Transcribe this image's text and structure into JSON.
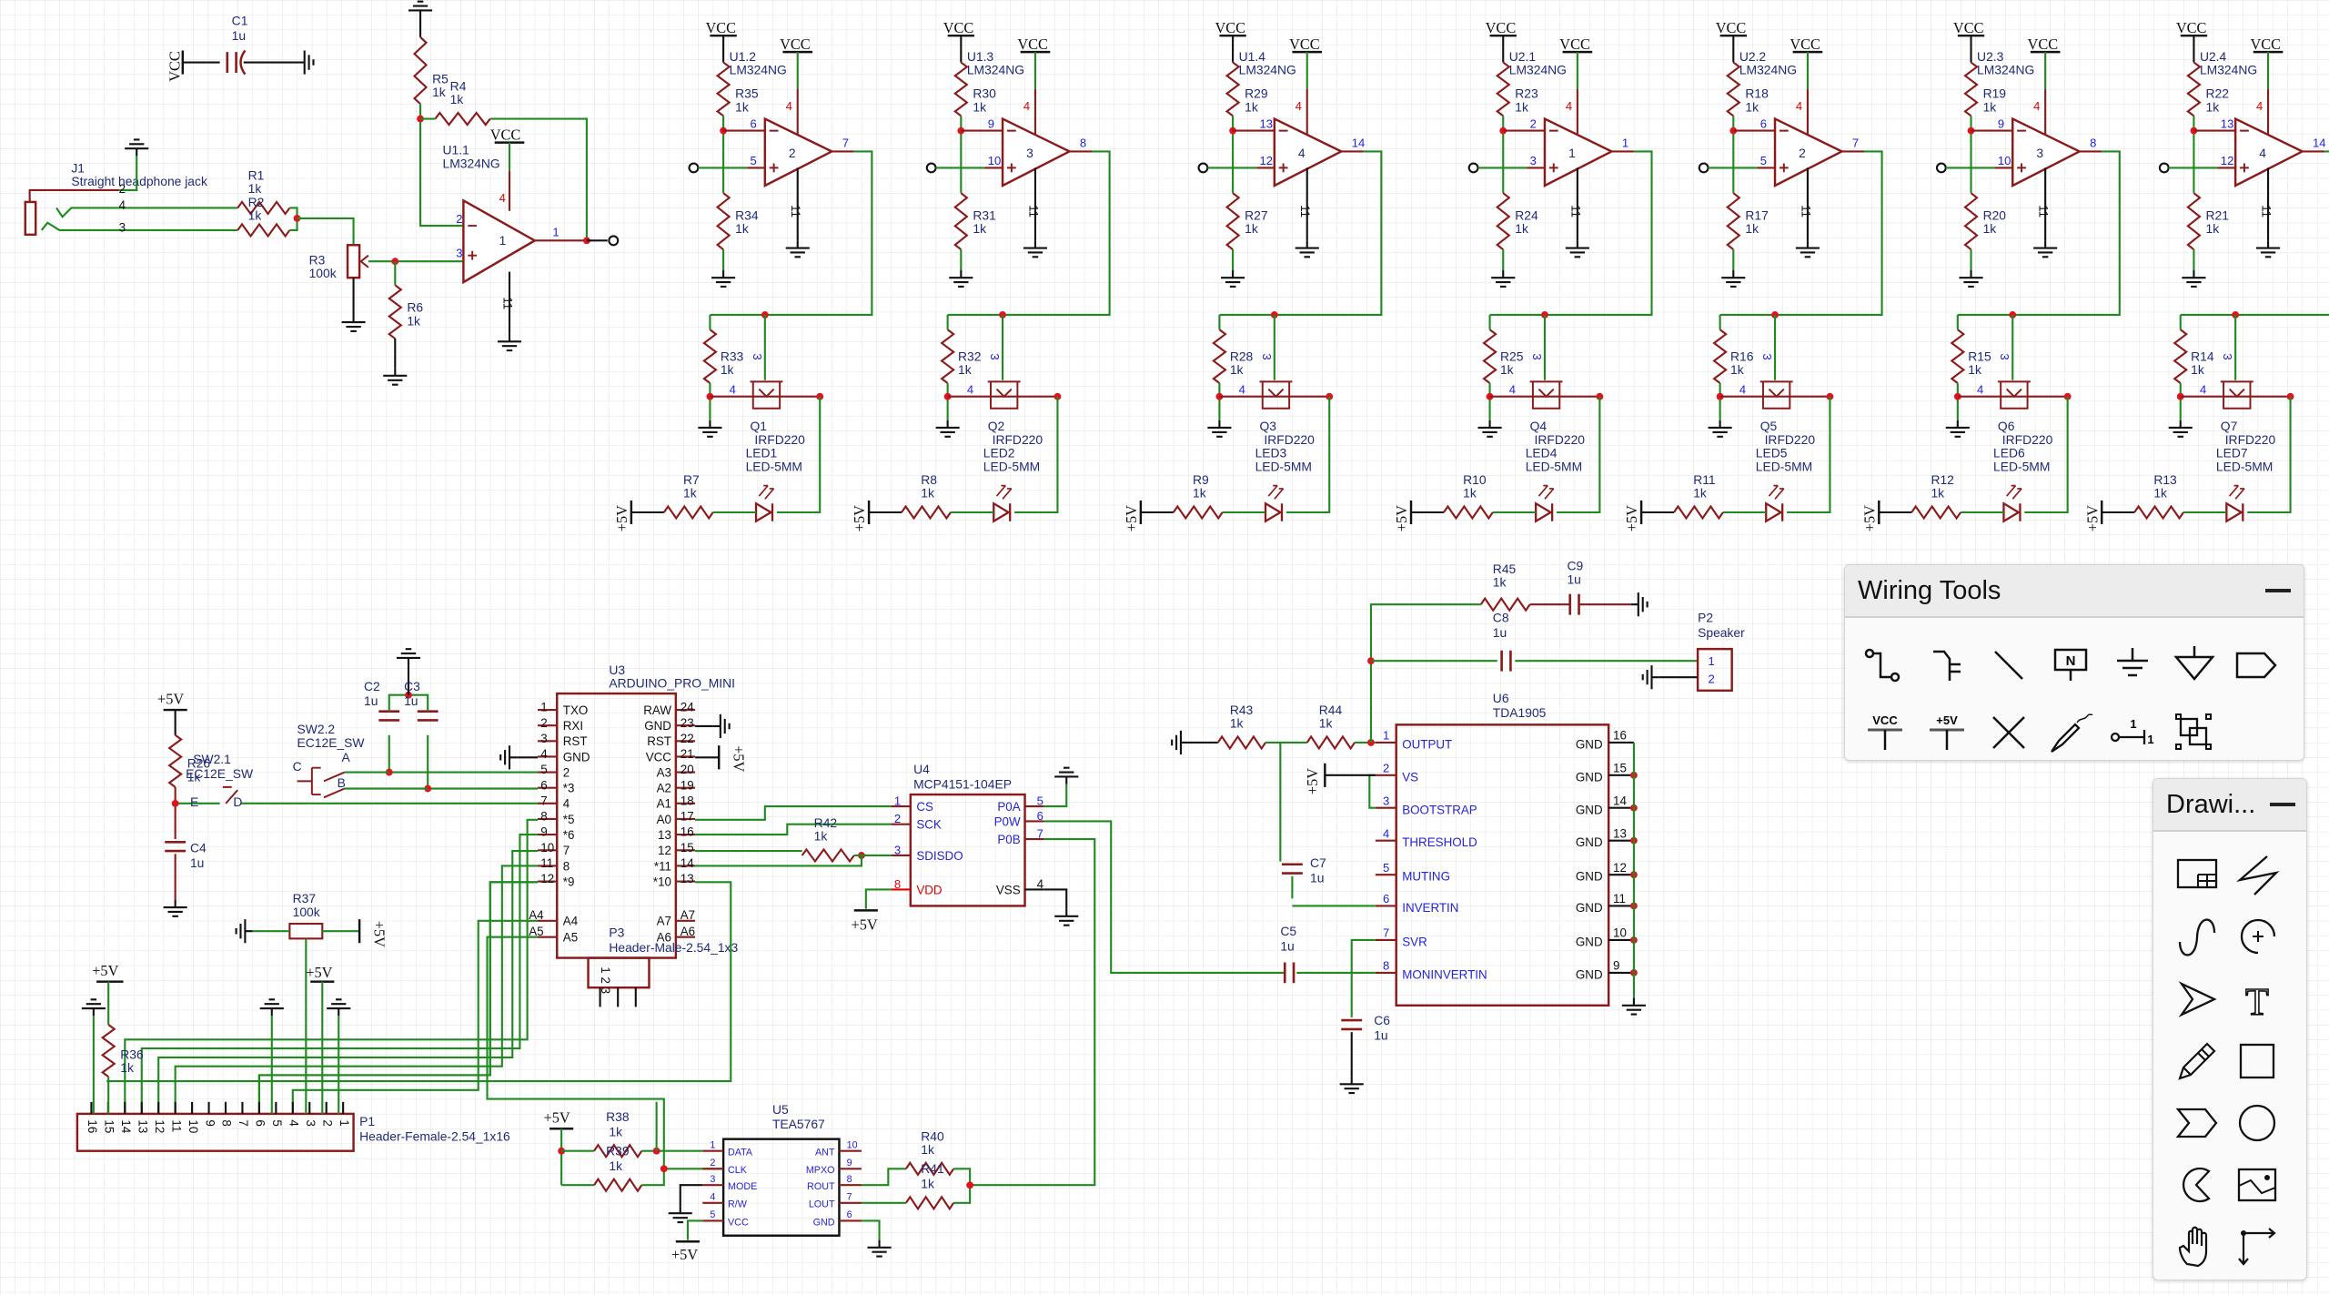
{
  "colors": {
    "wire": "#1f8a1f",
    "component": "#8b1a1a",
    "label": "#1e2a78",
    "pin_number": "#2020e0",
    "power_pin": "#e00000",
    "junction": "#e0141e",
    "grid": "#e2e2e2",
    "background": "#ffffff"
  },
  "wiring_tools": {
    "title": "Wiring Tools",
    "minimize_icon": "minus-icon",
    "tools": [
      {
        "icon": "wire-icon"
      },
      {
        "icon": "bus-icon"
      },
      {
        "icon": "bus-entry-icon"
      },
      {
        "icon": "net-label-icon",
        "glyph": "N"
      },
      {
        "icon": "ground-icon"
      },
      {
        "icon": "net-flag-gnd-icon"
      },
      {
        "icon": "net-port-icon"
      },
      {
        "icon": "vcc-flag-icon",
        "glyph": "VCC"
      },
      {
        "icon": "plus5v-flag-icon",
        "glyph": "+5V"
      },
      {
        "icon": "no-connect-icon"
      },
      {
        "icon": "probe-icon"
      },
      {
        "icon": "pin-icon",
        "glyph": "1"
      },
      {
        "icon": "group-icon"
      }
    ]
  },
  "drawing_tools": {
    "title": "Drawi...",
    "minimize_icon": "minus-icon",
    "tools": [
      {
        "icon": "frame-icon"
      },
      {
        "icon": "polyline-icon"
      },
      {
        "icon": "bezier-icon"
      },
      {
        "icon": "arc-icon"
      },
      {
        "icon": "arrowhead-icon"
      },
      {
        "icon": "text-icon",
        "glyph": "T"
      },
      {
        "icon": "freehand-icon"
      },
      {
        "icon": "rectangle-icon"
      },
      {
        "icon": "polygon-icon"
      },
      {
        "icon": "circle-icon"
      },
      {
        "icon": "pie-icon"
      },
      {
        "icon": "image-icon"
      },
      {
        "icon": "pan-icon"
      },
      {
        "icon": "canvas-origin-icon"
      }
    ]
  },
  "schematic": {
    "power": {
      "vcc": "VCC",
      "p5v": "+5V",
      "pin_vcc": "4",
      "pin_gnd": "11"
    },
    "stages": [
      {
        "unit": "U1.2",
        "part": "LM324NG",
        "r_top": "R35",
        "r_bottom": "R34",
        "pins": [
          "6",
          "5",
          "7"
        ],
        "unit_index": "2",
        "r_gate": "R33",
        "q": "Q1",
        "q_part": "IRFD220",
        "led": "LED1",
        "led_part": "LED-5MM",
        "r_series": "R7",
        "value": "1k",
        "q_pins": [
          "3",
          "4"
        ]
      },
      {
        "unit": "U1.3",
        "part": "LM324NG",
        "r_top": "R30",
        "r_bottom": "R31",
        "pins": [
          "9",
          "10",
          "8"
        ],
        "unit_index": "3",
        "r_gate": "R32",
        "q": "Q2",
        "q_part": "IRFD220",
        "led": "LED2",
        "led_part": "LED-5MM",
        "r_series": "R8",
        "value": "1k",
        "q_pins": [
          "3",
          "4"
        ]
      },
      {
        "unit": "U1.4",
        "part": "LM324NG",
        "r_top": "R29",
        "r_bottom": "R27",
        "pins": [
          "13",
          "12",
          "14"
        ],
        "unit_index": "4",
        "r_gate": "R28",
        "q": "Q3",
        "q_part": "IRFD220",
        "led": "LED3",
        "led_part": "LED-5MM",
        "r_series": "R9",
        "value": "1k",
        "q_pins": [
          "3",
          "4"
        ]
      },
      {
        "unit": "U2.1",
        "part": "LM324NG",
        "r_top": "R23",
        "r_bottom": "R24",
        "pins": [
          "2",
          "3",
          "1"
        ],
        "unit_index": "1",
        "r_gate": "R25",
        "q": "Q4",
        "q_part": "IRFD220",
        "led": "LED4",
        "led_part": "LED-5MM",
        "r_series": "R10",
        "value": "1k",
        "q_pins": [
          "3",
          "4"
        ]
      },
      {
        "unit": "U2.2",
        "part": "LM324NG",
        "r_top": "R18",
        "r_bottom": "R17",
        "pins": [
          "6",
          "5",
          "7"
        ],
        "unit_index": "2",
        "r_gate": "R16",
        "q": "Q5",
        "q_part": "IRFD220",
        "led": "LED5",
        "led_part": "LED-5MM",
        "r_series": "R11",
        "value": "1k",
        "q_pins": [
          "3",
          "4"
        ]
      },
      {
        "unit": "U2.3",
        "part": "LM324NG",
        "r_top": "R19",
        "r_bottom": "R20",
        "pins": [
          "9",
          "10",
          "8"
        ],
        "unit_index": "3",
        "r_gate": "R15",
        "q": "Q6",
        "q_part": "IRFD220",
        "led": "LED6",
        "led_part": "LED-5MM",
        "r_series": "R12",
        "value": "1k",
        "q_pins": [
          "3",
          "4"
        ]
      },
      {
        "unit": "U2.4",
        "part": "LM324NG",
        "r_top": "R22",
        "r_bottom": "R21",
        "pins": [
          "13",
          "12",
          "14"
        ],
        "unit_index": "4",
        "r_gate": "R14",
        "q": "Q7",
        "q_part": "IRFD220",
        "led": "LED7",
        "led_part": "LED-5MM",
        "r_series": "R13",
        "value": "1k",
        "q_pins": [
          "3",
          "4"
        ]
      }
    ],
    "input": {
      "c1": {
        "ref": "C1",
        "value": "1u"
      },
      "j1": {
        "ref": "J1",
        "part": "Straight headphone jack",
        "pins": [
          "2",
          "4",
          "3"
        ]
      },
      "r1": {
        "ref": "R1",
        "value": "1k"
      },
      "r2": {
        "ref": "R2",
        "value": "1k"
      },
      "r3": {
        "ref": "R3",
        "value": "100k"
      },
      "r4": {
        "ref": "R4",
        "value": "1k"
      },
      "r5": {
        "ref": "R5",
        "value": "1k"
      },
      "r6": {
        "ref": "R6",
        "value": "1k"
      },
      "u1_1": {
        "unit": "U1.1",
        "part": "LM324NG",
        "pins": [
          "2",
          "3",
          "1"
        ],
        "unit_index": "1"
      }
    },
    "u3": {
      "ref": "U3",
      "part": "ARDUINO_PRO_MINI",
      "left_pins": [
        [
          "1",
          "TXO"
        ],
        [
          "2",
          "RXI"
        ],
        [
          "3",
          "RST"
        ],
        [
          "4",
          "GND"
        ],
        [
          "5",
          "2"
        ],
        [
          "6",
          "*3"
        ],
        [
          "7",
          "4"
        ],
        [
          "8",
          "*5"
        ],
        [
          "9",
          "*6"
        ],
        [
          "10",
          "7"
        ],
        [
          "11",
          "8"
        ],
        [
          "12",
          "*9"
        ]
      ],
      "right_pins": [
        [
          "24",
          "RAW"
        ],
        [
          "23",
          "GND"
        ],
        [
          "22",
          "RST"
        ],
        [
          "21",
          "VCC"
        ],
        [
          "20",
          "A3"
        ],
        [
          "19",
          "A2"
        ],
        [
          "18",
          "A1"
        ],
        [
          "17",
          "A0"
        ],
        [
          "16",
          "13"
        ],
        [
          "15",
          "12"
        ],
        [
          "14",
          "*11"
        ],
        [
          "13",
          "*10"
        ]
      ],
      "bottom_left": [
        [
          "A4",
          "A4"
        ],
        [
          "A5",
          "A5"
        ]
      ],
      "bottom_right": [
        [
          "A7",
          "A7"
        ],
        [
          "A6",
          "A6"
        ]
      ]
    },
    "p3": {
      "ref": "P3",
      "part": "Header-Male-2.54_1x3",
      "pins": "1 2 3"
    },
    "u4": {
      "ref": "U4",
      "part": "MCP4151-104EP",
      "left_pins": [
        [
          "1",
          "CS"
        ],
        [
          "2",
          "SCK"
        ],
        [
          "3",
          "SDISDO"
        ],
        [
          "8",
          "VDD"
        ]
      ],
      "right_pins": [
        [
          "5",
          "P0A"
        ],
        [
          "6",
          "P0W"
        ],
        [
          "7",
          "P0B"
        ],
        [
          "4",
          "VSS"
        ]
      ]
    },
    "r42": {
      "ref": "R42",
      "value": "1k"
    },
    "u6": {
      "ref": "U6",
      "part": "TDA1905",
      "left_pins": [
        [
          "1",
          "OUTPUT"
        ],
        [
          "2",
          "VS"
        ],
        [
          "3",
          "BOOTSTRAP"
        ],
        [
          "4",
          "THRESHOLD"
        ],
        [
          "5",
          "MUTING"
        ],
        [
          "6",
          "INVERTIN"
        ],
        [
          "7",
          "SVR"
        ],
        [
          "8",
          "MONINVERTIN"
        ]
      ],
      "right_pins": [
        [
          "16",
          "GND"
        ],
        [
          "15",
          "GND"
        ],
        [
          "14",
          "GND"
        ],
        [
          "13",
          "GND"
        ],
        [
          "12",
          "GND"
        ],
        [
          "11",
          "GND"
        ],
        [
          "10",
          "GND"
        ],
        [
          "9",
          "GND"
        ]
      ]
    },
    "r43": {
      "ref": "R43",
      "value": "1k"
    },
    "r44": {
      "ref": "R44",
      "value": "1k"
    },
    "r45": {
      "ref": "R45",
      "value": "1k"
    },
    "c5": {
      "ref": "C5",
      "value": "1u"
    },
    "c6": {
      "ref": "C6",
      "value": "1u"
    },
    "c7": {
      "ref": "C7",
      "value": "1u"
    },
    "c8": {
      "ref": "C8",
      "value": "1u"
    },
    "c9": {
      "ref": "C9",
      "value": "1u"
    },
    "p2": {
      "ref": "P2",
      "part": "Speaker",
      "pins": [
        "1",
        "2"
      ]
    },
    "u5": {
      "ref": "U5",
      "part": "TEA5767",
      "left_pins": [
        [
          "1",
          "DATA"
        ],
        [
          "2",
          "CLK"
        ],
        [
          "3",
          "MODE"
        ],
        [
          "4",
          "R/W"
        ],
        [
          "5",
          "VCC"
        ]
      ],
      "right_pins": [
        [
          "10",
          "ANT"
        ],
        [
          "9",
          "MPXO"
        ],
        [
          "8",
          "ROUT"
        ],
        [
          "7",
          "LOUT"
        ],
        [
          "6",
          "GND"
        ]
      ]
    },
    "r38": {
      "ref": "R38",
      "value": "1k"
    },
    "r39": {
      "ref": "R39",
      "value": "1k"
    },
    "r40": {
      "ref": "R40",
      "value": "1k"
    },
    "r41": {
      "ref": "R41",
      "value": "1k"
    },
    "p1": {
      "ref": "P1",
      "part": "Header-Female-2.54_1x16",
      "pins": [
        "16",
        "15",
        "14",
        "13",
        "12",
        "11",
        "10",
        "9",
        "8",
        "7",
        "6",
        "5",
        "4",
        "3",
        "2",
        "1"
      ]
    },
    "r36": {
      "ref": "R36",
      "value": "1k"
    },
    "r37": {
      "ref": "R37",
      "value": "100k"
    },
    "r26": {
      "ref": "R26",
      "value": "1k"
    },
    "c2": {
      "ref": "C2",
      "value": "1u"
    },
    "c3": {
      "ref": "C3",
      "value": "1u"
    },
    "c4": {
      "ref": "C4",
      "value": "1u"
    },
    "sw2_1": {
      "ref": "SW2.1",
      "part": "EC12E_SW",
      "pins": [
        "E",
        "D"
      ]
    },
    "sw2_2": {
      "ref": "SW2.2",
      "part": "EC12E_SW",
      "pins": [
        "C",
        "B",
        "A"
      ]
    }
  }
}
